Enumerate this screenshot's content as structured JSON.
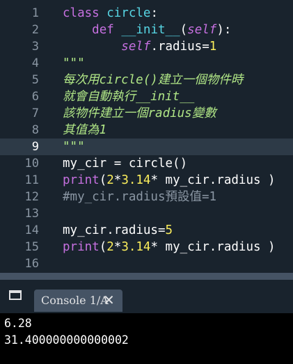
{
  "editor": {
    "lines": [
      {
        "n": "1",
        "tokens": [
          [
            "kw",
            "class "
          ],
          [
            "fn",
            "circle"
          ],
          [
            "pl",
            ":"
          ]
        ]
      },
      {
        "n": "2",
        "tokens": [
          [
            "pl",
            "    "
          ],
          [
            "kw",
            "def "
          ],
          [
            "fn",
            "__init__"
          ],
          [
            "pl",
            "("
          ],
          [
            "sf",
            "self"
          ],
          [
            "pl",
            "):"
          ]
        ]
      },
      {
        "n": "3",
        "tokens": [
          [
            "pl",
            "        "
          ],
          [
            "sf",
            "self"
          ],
          [
            "pl",
            ".radius="
          ],
          [
            "nm",
            "1"
          ]
        ]
      },
      {
        "n": "4",
        "tokens": [
          [
            "st",
            "\"\"\""
          ]
        ]
      },
      {
        "n": "5",
        "tokens": [
          [
            "st",
            "每次用circle()建立一個物件時"
          ]
        ]
      },
      {
        "n": "6",
        "tokens": [
          [
            "st",
            "就會自動執行__init__"
          ]
        ]
      },
      {
        "n": "7",
        "tokens": [
          [
            "st",
            "該物件建立一個radius變數"
          ]
        ]
      },
      {
        "n": "8",
        "tokens": [
          [
            "st",
            "其值為1"
          ]
        ]
      },
      {
        "n": "9",
        "tokens": [
          [
            "st",
            "\"\"\""
          ]
        ],
        "current": true
      },
      {
        "n": "10",
        "tokens": [
          [
            "pl",
            "my_cir = circle()"
          ]
        ]
      },
      {
        "n": "11",
        "tokens": [
          [
            "kw",
            "print"
          ],
          [
            "pl",
            "("
          ],
          [
            "nm",
            "2"
          ],
          [
            "pl",
            "*"
          ],
          [
            "nm",
            "3.14"
          ],
          [
            "pl",
            "* my_cir.radius )"
          ]
        ]
      },
      {
        "n": "12",
        "tokens": [
          [
            "cm",
            "#my_cir.radius預設值=1"
          ]
        ]
      },
      {
        "n": "13",
        "tokens": []
      },
      {
        "n": "14",
        "tokens": [
          [
            "pl",
            "my_cir.radius="
          ],
          [
            "nm",
            "5"
          ]
        ]
      },
      {
        "n": "15",
        "tokens": [
          [
            "kw",
            "print"
          ],
          [
            "pl",
            "("
          ],
          [
            "nm",
            "2"
          ],
          [
            "pl",
            "*"
          ],
          [
            "nm",
            "3.14"
          ],
          [
            "pl",
            "* my_cir.radius )"
          ]
        ]
      },
      {
        "n": "16",
        "tokens": []
      }
    ]
  },
  "console": {
    "tab_label": "Console 1/A",
    "close_glyph": "✕",
    "output": [
      "6.28",
      "31.400000000000002"
    ]
  },
  "colors": {
    "background": "#19232d",
    "keyword": "#c670e0",
    "function": "#57d6e4",
    "number": "#faed5c",
    "string": "#b0e686",
    "comment": "#8a96a3",
    "console_bg": "#000000"
  }
}
